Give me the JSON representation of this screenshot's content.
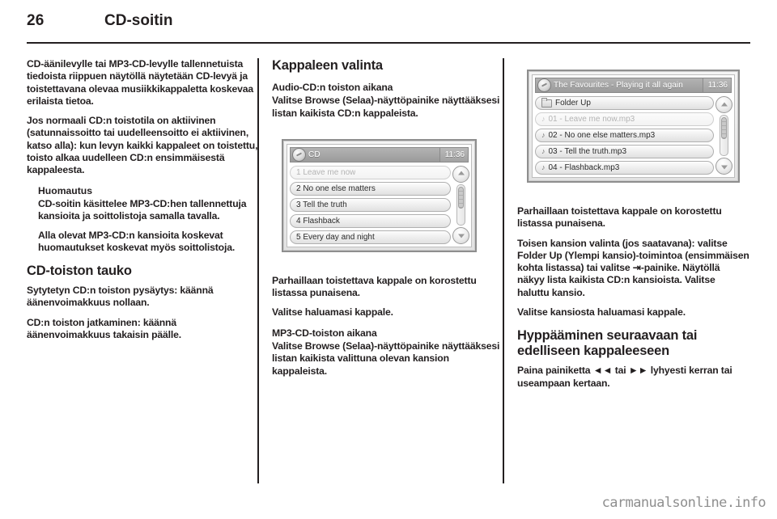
{
  "header": {
    "page_number": "26",
    "title": "CD-soitin"
  },
  "column_left": {
    "para_1": "CD-äänilevylle tai MP3-CD-levylle tallennetuista tiedoista riippuen näytöllä näytetään CD-levyä ja toistettavana olevaa musiikkikappaletta koskevaa erilaista tietoa.",
    "para_2": "Jos normaali CD:n toistotila on aktiivinen (satunnaissoitto tai uudelleensoitto ei aktiivinen, katso alla): kun levyn kaikki kappaleet on toistettu, toisto alkaa uudelleen CD:n ensimmäisestä kappaleesta.",
    "note_title": "Huomautus",
    "note_para_1": "CD-soitin käsittelee MP3-CD:hen tallennettuja kansioita ja soittolistoja samalla tavalla.",
    "note_para_2": "Alla olevat MP3-CD:n kansioita koskevat huomautukset koskevat myös soittolistoja.",
    "heading_pause": "CD-toiston tauko",
    "para_3": "Sytytetyn CD:n toiston pysäytys: käännä äänenvoimakkuus nollaan.",
    "para_4": "CD:n toiston jatkaminen: käännä äänenvoimakkuus takaisin päälle."
  },
  "column_middle": {
    "heading_select": "Kappaleen valinta",
    "subheading_audio_cd": "Audio-CD:n toiston aikana",
    "para_1": "Valitse Browse (Selaa)-näyttöpainike näyttääksesi listan kaikista CD:n kappaleista.",
    "para_2": "Parhaillaan toistettava kappale on korostettu listassa punaisena.",
    "para_3": "Valitse haluamasi kappale.",
    "subheading_mp3_cd": "MP3-CD-toiston aikana",
    "para_4": "Valitse Browse (Selaa)-näyttöpainike näyttääksesi listan kaikista valittuna olevan kansion kappaleista."
  },
  "column_right": {
    "para_1": "Parhaillaan toistettava kappale on korostettu listassa punaisena.",
    "para_2": "Toisen kansion valinta (jos saatavana): valitse Folder Up (Ylempi kansio)-toimintoa (ensimmäisen kohta listassa) tai valitse ⇥-painike. Näytöllä näkyy lista kaikista CD:n kansioista. Valitse haluttu kansio.",
    "para_3": "Valitse kansiosta haluamasi kappale.",
    "heading_skip": "Hyppääminen seuraavaan tai edelliseen kappaleeseen",
    "para_4": "Paina painiketta ◄◄ tai ►► lyhyesti kerran tai useampaan kertaan."
  },
  "screen_cd": {
    "title": "CD",
    "clock": "11:36",
    "icon": "disc-icon",
    "rows": [
      {
        "label": "1 Leave me now",
        "dim": true
      },
      {
        "label": "2 No one else matters",
        "dim": false
      },
      {
        "label": "3 Tell the truth",
        "dim": false
      },
      {
        "label": "4 Flashback",
        "dim": false
      },
      {
        "label": "5 Every day and night",
        "dim": false
      }
    ],
    "scroll_up": "scroll-up-arrow",
    "scroll_down": "scroll-down-arrow"
  },
  "screen_favourites": {
    "title": "The Favourites - Playing it all again",
    "clock": "11:36",
    "icon": "disc-icon",
    "rows": [
      {
        "label": "Folder Up",
        "glyph": "folder",
        "dim": false
      },
      {
        "label": "01 - Leave me now.mp3",
        "glyph": "note",
        "dim": true
      },
      {
        "label": "02 - No one else matters.mp3",
        "glyph": "note",
        "dim": false
      },
      {
        "label": "03 - Tell the truth.mp3",
        "glyph": "note",
        "dim": false
      },
      {
        "label": "04 - Flashback.mp3",
        "glyph": "note",
        "dim": false
      }
    ],
    "note_glyph": "♪",
    "scroll_up": "scroll-up-arrow",
    "scroll_down": "scroll-down-arrow"
  },
  "watermark": {
    "text": "carmanualsonline.info"
  }
}
